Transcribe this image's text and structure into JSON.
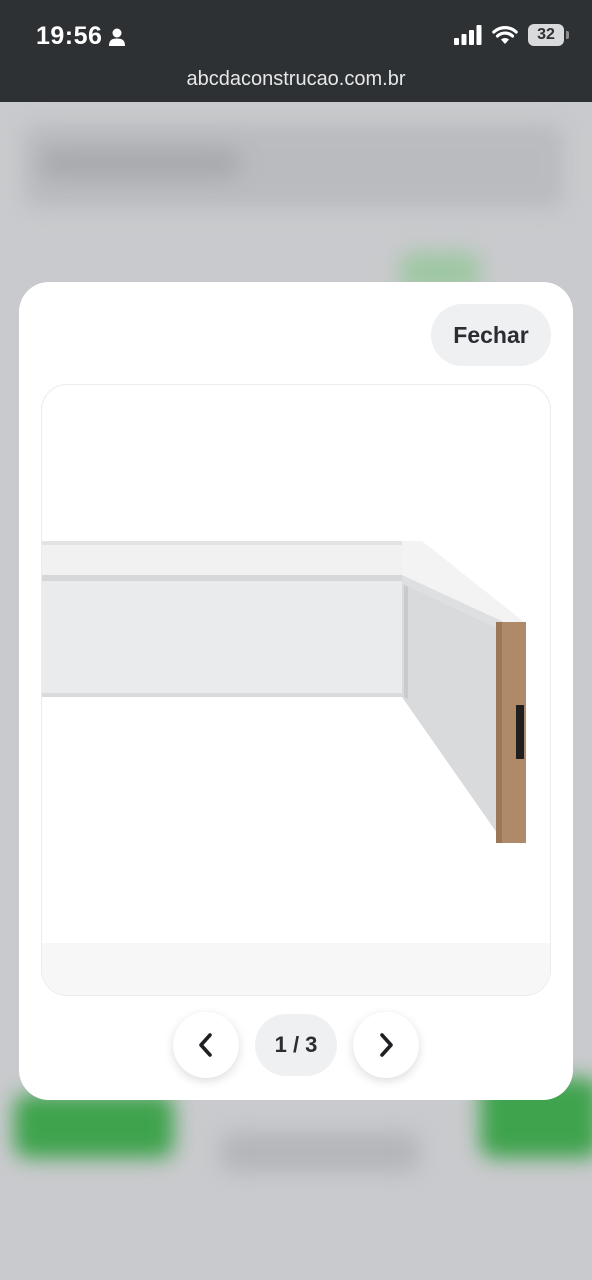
{
  "status_bar": {
    "time": "19:56",
    "battery": "32",
    "icons": [
      "person-icon",
      "signal-icon",
      "wifi-icon",
      "battery-icon"
    ]
  },
  "browser": {
    "url": "abcdaconstrucao.com.br"
  },
  "modal": {
    "close_label": "Fechar",
    "image_alt": "rodapé branco",
    "pager": {
      "indicator": "1 / 3",
      "prev_icon": "chevron-left-icon",
      "next_icon": "chevron-right-icon"
    }
  },
  "colors": {
    "status_bar_bg": "#2e3133",
    "overlay_bg": "#c9cacd",
    "modal_bg": "#ffffff",
    "pill_bg": "#eff0f2",
    "text_dark": "#2b2d33",
    "blurred_green": "#3fa34d",
    "wood_edge": "#b08a68"
  }
}
